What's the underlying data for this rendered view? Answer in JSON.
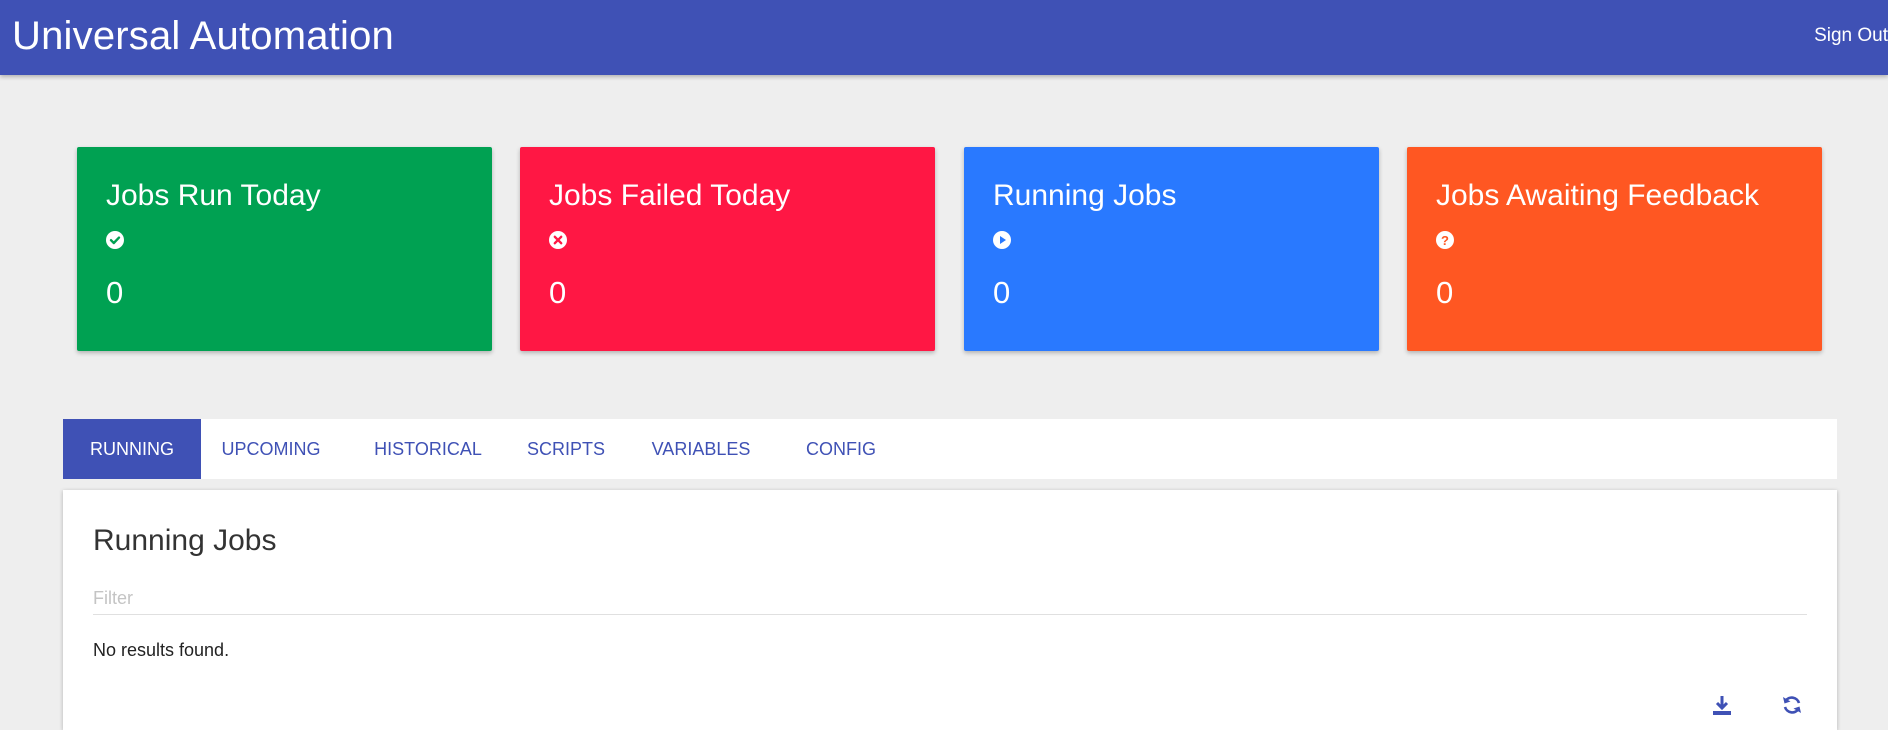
{
  "app": {
    "title": "Universal Automation",
    "sign_out_label": "Sign Out",
    "accent_color": "#3f51b5"
  },
  "cards": [
    {
      "title": "Jobs Run Today",
      "icon": "check-circle-icon",
      "value": "0",
      "color": "#00a152"
    },
    {
      "title": "Jobs Failed Today",
      "icon": "x-circle-icon",
      "value": "0",
      "color": "#ff1744"
    },
    {
      "title": "Running Jobs",
      "icon": "play-circle-icon",
      "value": "0",
      "color": "#2979ff"
    },
    {
      "title": "Jobs Awaiting Feedback",
      "icon": "question-circle-icon",
      "value": "0",
      "color": "#ff5722"
    }
  ],
  "tabs": [
    {
      "label": "RUNNING",
      "active": true
    },
    {
      "label": "UPCOMING",
      "active": false
    },
    {
      "label": "HISTORICAL",
      "active": false
    },
    {
      "label": "SCRIPTS",
      "active": false
    },
    {
      "label": "VARIABLES",
      "active": false
    },
    {
      "label": "CONFIG",
      "active": false
    }
  ],
  "panel": {
    "title": "Running Jobs",
    "filter_placeholder": "Filter",
    "filter_value": "",
    "empty_message": "No results found.",
    "actions": [
      {
        "icon": "download-icon"
      },
      {
        "icon": "refresh-icon"
      }
    ]
  }
}
